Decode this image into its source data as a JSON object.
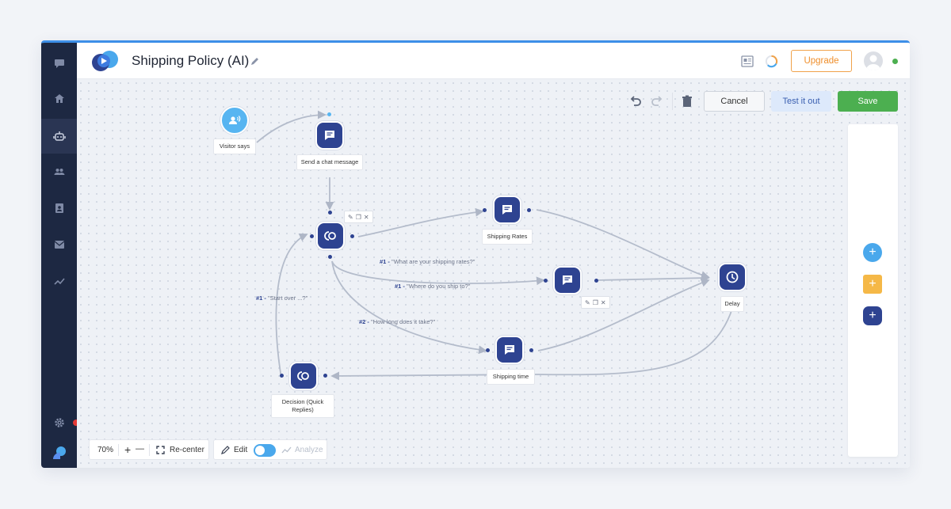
{
  "app": {
    "title": "Shipping Policy (AI)"
  },
  "header": {
    "upgrade_label": "Upgrade",
    "status_color": "#4caf50"
  },
  "toolbar": {
    "cancel_label": "Cancel",
    "test_label": "Test it out",
    "save_label": "Save"
  },
  "sidebar": {
    "items": [
      {
        "icon": "chat-icon"
      },
      {
        "icon": "home-icon"
      },
      {
        "icon": "bot-icon",
        "active": true
      },
      {
        "icon": "contacts-icon"
      },
      {
        "icon": "address-book-icon"
      },
      {
        "icon": "mail-icon"
      },
      {
        "icon": "analytics-icon"
      }
    ],
    "bottom": [
      {
        "icon": "gear-icon"
      },
      {
        "icon": "logo-icon"
      }
    ]
  },
  "flow": {
    "nodes": [
      {
        "id": "visitor",
        "label": "Visitor says",
        "icon": "voice-user-icon"
      },
      {
        "id": "send",
        "label": "Send a chat message",
        "icon": "chat-bubble-icon"
      },
      {
        "id": "decision1",
        "label": "",
        "icon": "decision-icon"
      },
      {
        "id": "rates",
        "label": "Shipping Rates",
        "icon": "chat-bubble-icon"
      },
      {
        "id": "where",
        "label": "",
        "icon": "chat-bubble-icon"
      },
      {
        "id": "delay",
        "label": "Delay",
        "icon": "clock-icon"
      },
      {
        "id": "time",
        "label": "Shipping time",
        "icon": "chat-bubble-icon"
      },
      {
        "id": "decision2",
        "label": "Decision (Quick Replies)",
        "icon": "decision-icon"
      }
    ],
    "edges": [
      {
        "prefix": "#1 -",
        "text": "\"What are your shipping rates?\""
      },
      {
        "prefix": "#1 -",
        "text": "\"Where do you ship to?\""
      },
      {
        "prefix": "#2 -",
        "text": "\"How long does it take?\""
      },
      {
        "prefix": "#1 -",
        "text": "\"Start over ...?\""
      }
    ]
  },
  "zoom": {
    "level": "70%",
    "plus": "+",
    "minus": "—",
    "recenter_label": "Re-center"
  },
  "mode": {
    "edit_label": "Edit",
    "analyze_label": "Analyze"
  },
  "right_panel": {
    "buttons": [
      {
        "icon": "plus-icon",
        "color": "#4aa8ec"
      },
      {
        "icon": "plus-icon",
        "color": "#f5b847"
      },
      {
        "icon": "plus-icon",
        "color": "#2e4391"
      }
    ]
  }
}
